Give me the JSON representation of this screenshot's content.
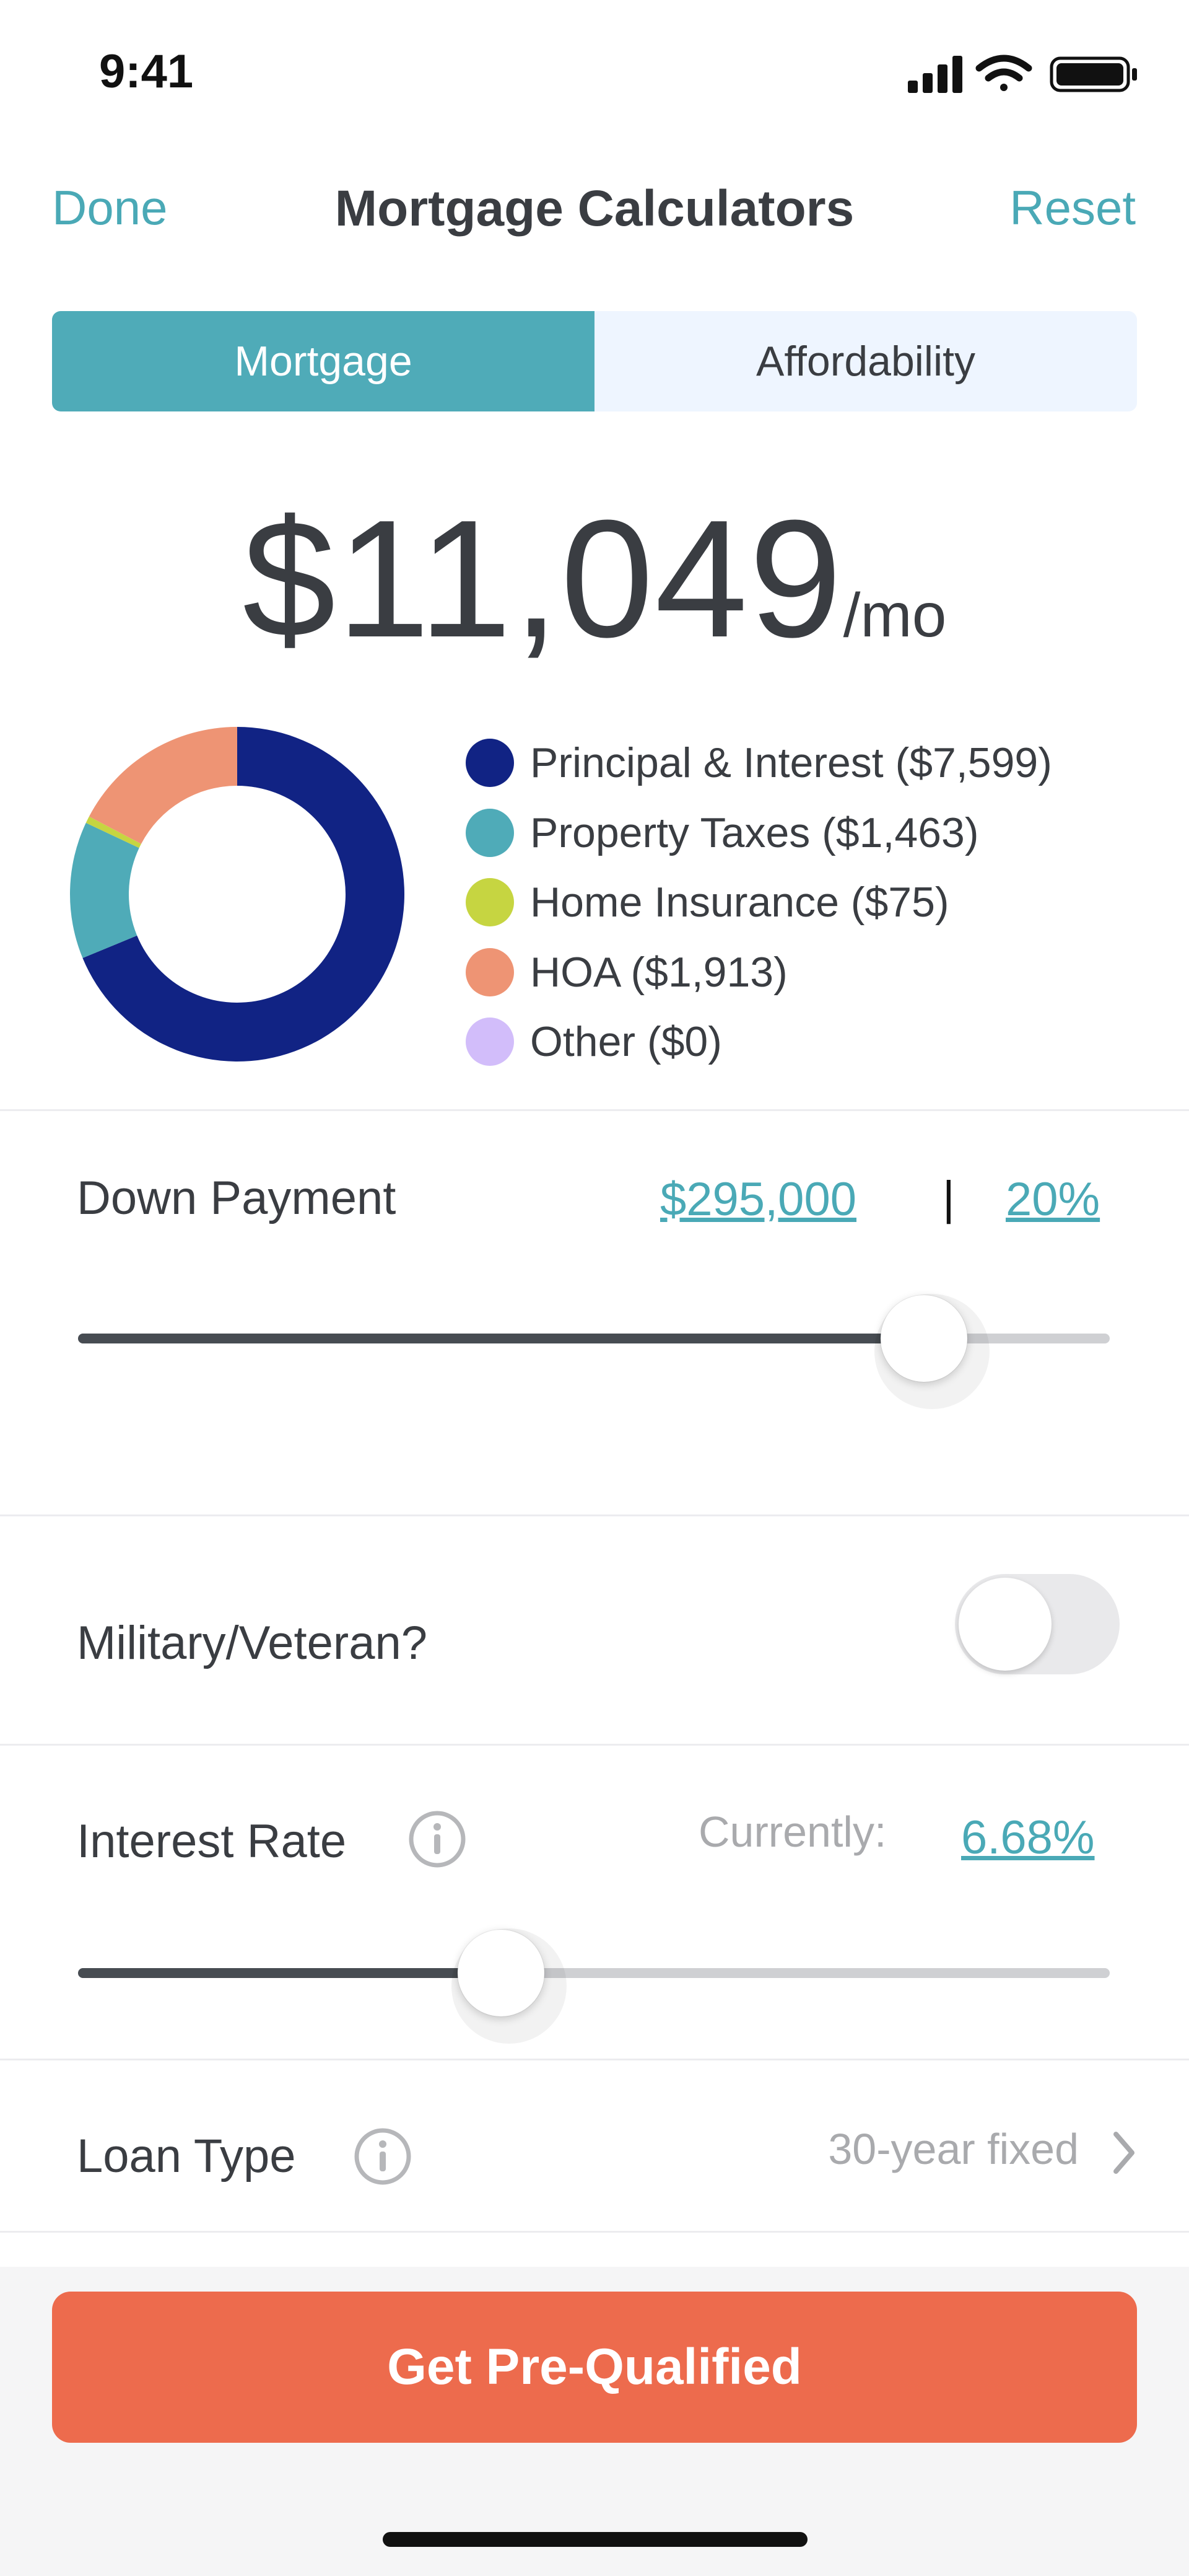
{
  "status_bar": {
    "time": "9:41"
  },
  "nav": {
    "done": "Done",
    "title": "Mortgage Calculators",
    "reset": "Reset"
  },
  "tabs": [
    {
      "label": "Mortgage",
      "active": true
    },
    {
      "label": "Affordability",
      "active": false
    }
  ],
  "monthly": {
    "amount": "$11,049",
    "unit": "/mo"
  },
  "breakdown": [
    {
      "label": "Principal & Interest ($7,599)",
      "value": 7599,
      "color": "#112384"
    },
    {
      "label": "Property Taxes ($1,463)",
      "value": 1463,
      "color": "#4fabb8"
    },
    {
      "label": "Home Insurance ($75)",
      "value": 75,
      "color": "#c6d541"
    },
    {
      "label": "HOA ($1,913)",
      "value": 1913,
      "color": "#ee9474"
    },
    {
      "label": "Other ($0)",
      "value": 0,
      "color": "#d2bdfa"
    }
  ],
  "down_payment": {
    "label": "Down Payment",
    "amount": "$295,000",
    "separator": "|",
    "percent": "20%",
    "slider_fraction": 0.82
  },
  "military": {
    "label": "Military/Veteran?",
    "enabled": false
  },
  "interest_rate": {
    "label": "Interest Rate",
    "current_label": "Currently:",
    "value": "6.68%",
    "slider_fraction": 0.41
  },
  "loan_type": {
    "label": "Loan Type",
    "value": "30-year fixed"
  },
  "cta": {
    "label": "Get Pre-Qualified"
  },
  "colors": {
    "accent": "#4fabb8",
    "cta": "#ed6b4d",
    "text": "#3a3d42"
  }
}
